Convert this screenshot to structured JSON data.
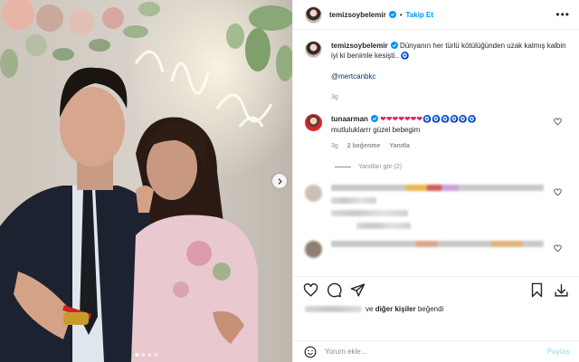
{
  "post": {
    "username": "temizsoybelemir",
    "separator": "•",
    "follow_label": "Takip Et",
    "more_label": "•••"
  },
  "caption": {
    "username": "temizsoybelemir",
    "text": "Dünyanın her türlü kötülüğünden uzak kalmış kalbin iyi ki benimle kesişti..",
    "emoji": "🧿",
    "mention": "@mertcanbkc",
    "time": "3g"
  },
  "comment": {
    "username": "tunaarman",
    "hearts": "❤❤❤❤❤❤❤",
    "eyes": "🧿🧿🧿🧿🧿🧿",
    "text": "mutluluklarrr güzel bebegim",
    "time": "3g",
    "likes": "2 beğenme",
    "reply_label": "Yanıtla",
    "view_replies": "Yanıtları gör (2)"
  },
  "likes_summary": {
    "suffix_prefix": "ve",
    "others": "diğer kişiler",
    "suffix": "beğendi"
  },
  "comment_input": {
    "placeholder": "Yorum ekle...",
    "post_label": "Paylaş"
  },
  "carousel": {
    "slide_count": 4,
    "active_slide": 1
  },
  "colors": {
    "link_blue": "#0095f6",
    "mention_blue": "#00376b",
    "muted_gray": "#8e8e8e",
    "post_disabled": "#b2dffc"
  },
  "icons": [
    "verified-badge-icon",
    "more-options-icon",
    "heart-icon",
    "comment-icon",
    "share-icon",
    "bookmark-icon",
    "download-icon",
    "emoji-icon",
    "chevron-right-icon"
  ]
}
